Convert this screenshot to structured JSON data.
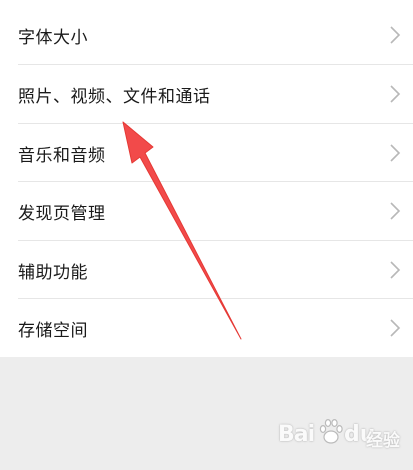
{
  "settings": {
    "items": [
      {
        "label": "字体大小",
        "icon": "chevron-right-icon"
      },
      {
        "label": "照片、视频、文件和通话",
        "icon": "chevron-right-icon"
      },
      {
        "label": "音乐和音频",
        "icon": "chevron-right-icon"
      },
      {
        "label": "发现页管理",
        "icon": "chevron-right-icon"
      },
      {
        "label": "辅助功能",
        "icon": "chevron-right-icon"
      },
      {
        "label": "存储空间",
        "icon": "chevron-right-icon"
      }
    ]
  },
  "annotation": {
    "arrow_color": "#f24a4a"
  },
  "watermark": {
    "brand_prefix": "Bai",
    "brand_suffix": "du",
    "product": "经验"
  },
  "colors": {
    "list_background": "#ffffff",
    "page_background": "#ededed",
    "text": "#1a1a1a",
    "chevron": "#b8b8b8",
    "divider": "#e6e6e6"
  }
}
